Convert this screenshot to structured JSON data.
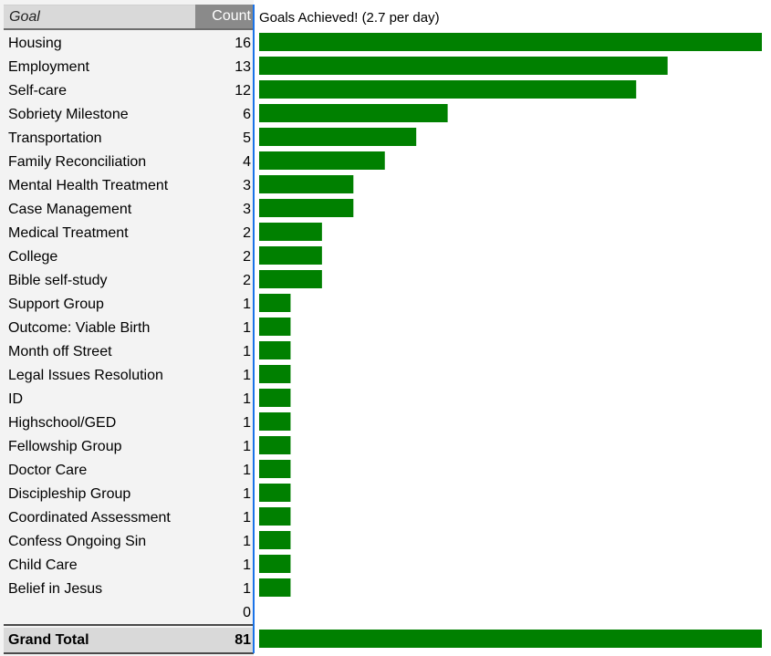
{
  "table": {
    "header_goal": "Goal",
    "header_count": "Count",
    "grand_total_label": "Grand Total",
    "grand_total_value": "81"
  },
  "chart_data": {
    "type": "bar",
    "orientation": "horizontal",
    "title": "Goals Achieved! (2.7 per day)",
    "categories": [
      "Housing",
      "Employment",
      "Self-care",
      "Sobriety Milestone",
      "Transportation",
      "Family Reconciliation",
      "Mental Health Treatment",
      "Case Management",
      "Medical Treatment",
      "College",
      "Bible self-study",
      "Support Group",
      "Outcome: Viable Birth",
      "Month off Street",
      "Legal Issues Resolution",
      "ID",
      "Highschool/GED",
      "Fellowship Group",
      "Doctor Care",
      "Discipleship Group",
      "Coordinated Assessment",
      "Confess Ongoing Sin",
      "Child Care",
      "Belief in Jesus",
      ""
    ],
    "values": [
      16,
      13,
      12,
      6,
      5,
      4,
      3,
      3,
      2,
      2,
      2,
      1,
      1,
      1,
      1,
      1,
      1,
      1,
      1,
      1,
      1,
      1,
      1,
      1,
      0
    ],
    "grand_total": 81,
    "bar_color": "#008000",
    "xlim": [
      0,
      16
    ],
    "grid": false,
    "legend": "none"
  }
}
